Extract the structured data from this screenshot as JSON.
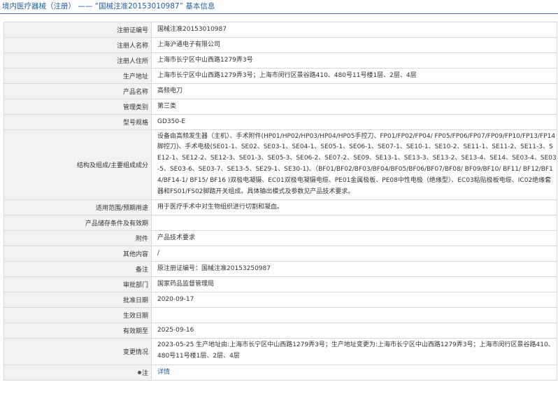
{
  "header": {
    "title": "境内医疗器械（注册） —— “国械注准20153010987” 基本信息"
  },
  "rows": [
    {
      "label": "注册证编号",
      "value": "国械注准20153010987"
    },
    {
      "label": "注册人名称",
      "value": "上海沪通电子有限公司"
    },
    {
      "label": "注册人住所",
      "value": "上海市长宁区中山西路1279弄3号"
    },
    {
      "label": "生产地址",
      "value": "上海市长宁区中山西路1279弄3号；上海市闵行区景谷路410、480号11号楼1层、2层、4层"
    },
    {
      "label": "产品名称",
      "value": "高频电刀"
    },
    {
      "label": "管理类别",
      "value": "第三类"
    },
    {
      "label": "型号规格",
      "value": "GD350-E"
    },
    {
      "label": "结构及组成/主要组成成分",
      "value": "设备由高频发生器（主机）、手术附件(HP01/HP02/HP03/HP04/HP05手控刀、FP01/FP02/FP04/ FP05/FP06/FP07/FP09/FP10/FP13/FP14脚控刀)、手术电极(SE01-1、SE02、SE03-1、SE04-1、SE05-1、SE06-1、SE07-1、SE10-1、SE10-2、SE11-1、SE11-2、SE11-3、SE12-1、SE12-2、SE12-3、SE01-3、SE05-3、SE06-2、SE07-2、SE09、SE13-1、SE13-3、SE13-2、SE13-4、SE14、SE03-4、SE03-5、SE03-6、SE03-7、SE13-5、SE29-1、SE30-1)、（BF01/BF02/BF03/BF04/BF05/BF06/BF07/BF08/ BF09/BF10/ BF11/ BF12/BF14/BF14-1/ BF15/ BF16 )双极电凝镊、EC01双极电凝镊电缆、PE01金属极板、PE08中性电极（绝缘型）、EC03粘贴极板电缆、IC02绝缘套器和FS01/FS02脚踏开关组成。具体输出模式及参数见产品技术要求。"
    },
    {
      "label": "适用范围/预期用途",
      "value": "用于医疗手术中对生物组织进行切割和凝血。"
    },
    {
      "label": "产品储存条件及有效期",
      "value": ""
    },
    {
      "label": "附件",
      "value": "产品技术要求"
    },
    {
      "label": "其他内容",
      "value": "/"
    },
    {
      "label": "备注",
      "value": "原注册证编号：国械注准20153250987"
    },
    {
      "label": "审批部门",
      "value": "国家药品监督管理局"
    },
    {
      "label": "批准日期",
      "value": "2020-09-17"
    },
    {
      "label": "生效日期",
      "value": ""
    },
    {
      "label": "有效期至",
      "value": "2025-09-16"
    },
    {
      "label": "变更情况",
      "value": "2023-05-25 生产地址由:上海市长宁区中山西路1279弄3号；生产地址变更为:上海市长宁区中山西路1279弄3号；上海市闵行区景谷路410、480号11号楼1层、2层、4层"
    },
    {
      "label": "注",
      "value": "详情"
    }
  ]
}
